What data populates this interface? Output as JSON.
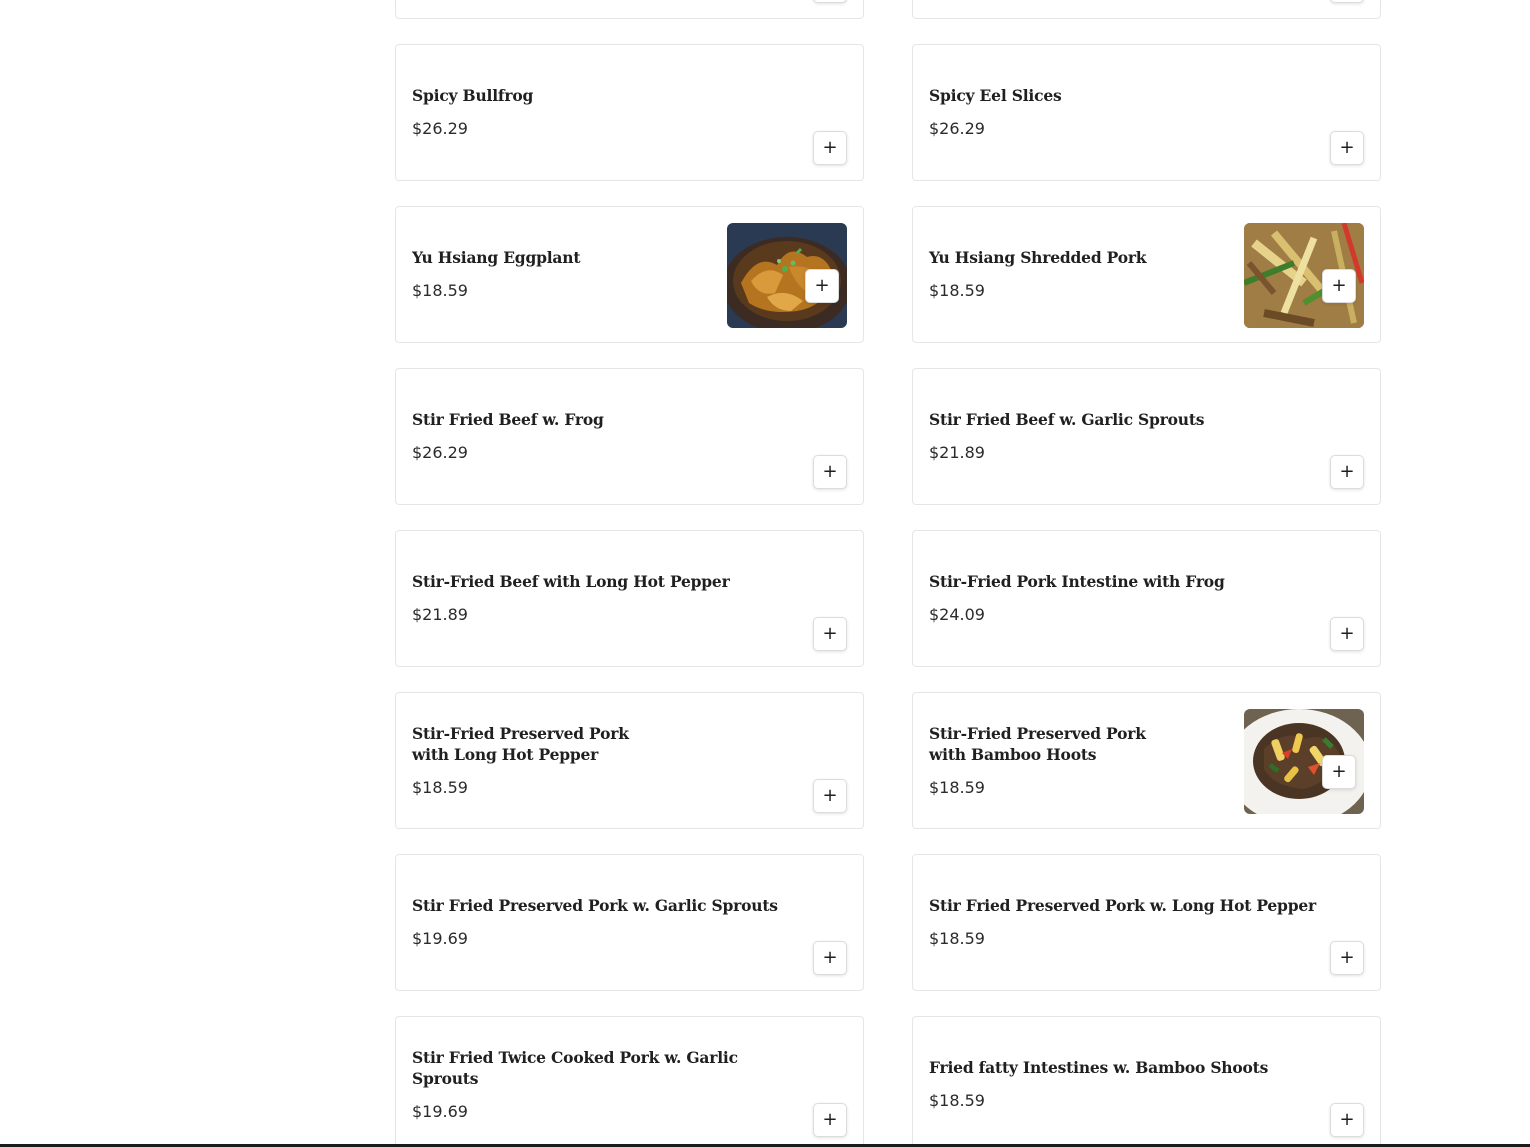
{
  "menu": {
    "items": [
      {
        "name": "",
        "price": "",
        "image": null
      },
      {
        "name": "",
        "price": "",
        "image": null
      },
      {
        "name": "Spicy Bullfrog",
        "price": "$26.29",
        "image": null
      },
      {
        "name": "Spicy Eel Slices",
        "price": "$26.29",
        "image": null
      },
      {
        "name": "Yu Hsiang Eggplant",
        "price": "$18.59",
        "image": "braised-dish-photo"
      },
      {
        "name": "Yu Hsiang Shredded Pork",
        "price": "$18.59",
        "image": "shredded-pork-photo"
      },
      {
        "name": "Stir Fried Beef w. Frog",
        "price": "$26.29",
        "image": null
      },
      {
        "name": "Stir Fried Beef w. Garlic Sprouts",
        "price": "$21.89",
        "image": null
      },
      {
        "name": "Stir-Fried Beef with Long Hot Pepper",
        "price": "$21.89",
        "image": null
      },
      {
        "name": "Stir-Fried Pork Intestine with Frog",
        "price": "$24.09",
        "image": null
      },
      {
        "name": "Stir-Fried Preserved Pork\nwith Long Hot Pepper",
        "price": "$18.59",
        "image": null
      },
      {
        "name": "Stir-Fried Preserved Pork\nwith Bamboo Hoots",
        "price": "$18.59",
        "image": "bamboo-pork-photo"
      },
      {
        "name": "Stir Fried Preserved Pork w. Garlic Sprouts",
        "price": "$19.69",
        "image": null
      },
      {
        "name": "Stir Fried Preserved Pork w. Long Hot Pepper",
        "price": "$18.59",
        "image": null
      },
      {
        "name": "Stir Fried Twice Cooked Pork w. Garlic Sprouts",
        "price": "$19.69",
        "image": null
      },
      {
        "name": "Fried fatty Intestines w. Bamboo Shoots",
        "price": "$18.59",
        "image": null
      }
    ],
    "add_button_label": "+"
  },
  "colors": {
    "card_border": "#e6e6e6",
    "text": "#202020",
    "bottom_bar": "#1c1c1c"
  }
}
